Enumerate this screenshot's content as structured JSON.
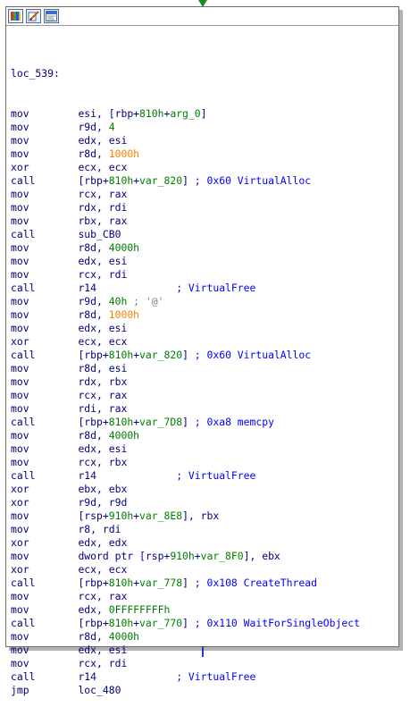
{
  "toolbar": {
    "buttons": [
      {
        "name": "color-palette-icon"
      },
      {
        "name": "edit-node-icon"
      },
      {
        "name": "graph-view-icon"
      }
    ]
  },
  "label": "loc_539:",
  "lines": [
    {
      "m": "mov",
      "p": [
        [
          "esi, [rbp+",
          "op"
        ],
        [
          "810h",
          "num"
        ],
        [
          "+",
          "op"
        ],
        [
          "arg_0",
          "var"
        ],
        [
          "]",
          "op"
        ]
      ]
    },
    {
      "m": "mov",
      "p": [
        [
          "r9d, ",
          "op"
        ],
        [
          "4",
          "num"
        ]
      ]
    },
    {
      "m": "mov",
      "p": [
        [
          "edx, esi",
          "op"
        ]
      ]
    },
    {
      "m": "mov",
      "p": [
        [
          "r8d, ",
          "op"
        ],
        [
          "1000h",
          "addr"
        ]
      ]
    },
    {
      "m": "xor",
      "p": [
        [
          "ecx, ecx",
          "op"
        ]
      ]
    },
    {
      "m": "call",
      "p": [
        [
          "[rbp+",
          "op"
        ],
        [
          "810h",
          "num"
        ],
        [
          "+",
          "op"
        ],
        [
          "var_820",
          "var"
        ],
        [
          "] ",
          "op"
        ],
        [
          "; 0x60 VirtualAlloc",
          "cmt"
        ]
      ]
    },
    {
      "m": "mov",
      "p": [
        [
          "rcx, rax",
          "op"
        ]
      ]
    },
    {
      "m": "mov",
      "p": [
        [
          "rdx, rdi",
          "op"
        ]
      ]
    },
    {
      "m": "mov",
      "p": [
        [
          "rbx, rax",
          "op"
        ]
      ]
    },
    {
      "m": "call",
      "p": [
        [
          "sub_CB0",
          "op"
        ]
      ]
    },
    {
      "m": "mov",
      "p": [
        [
          "r8d, ",
          "op"
        ],
        [
          "4000h",
          "num"
        ]
      ]
    },
    {
      "m": "mov",
      "p": [
        [
          "edx, esi",
          "op"
        ]
      ]
    },
    {
      "m": "mov",
      "p": [
        [
          "rcx, rdi",
          "op"
        ]
      ]
    },
    {
      "m": "call",
      "p": [
        [
          "r14             ",
          "op"
        ],
        [
          "; VirtualFree",
          "cmt"
        ]
      ]
    },
    {
      "m": "mov",
      "p": [
        [
          "r9d, ",
          "op"
        ],
        [
          "40h",
          "num"
        ],
        [
          " ; '@'",
          "str"
        ]
      ]
    },
    {
      "m": "mov",
      "p": [
        [
          "r8d, ",
          "op"
        ],
        [
          "1000h",
          "addr"
        ]
      ]
    },
    {
      "m": "mov",
      "p": [
        [
          "edx, esi",
          "op"
        ]
      ]
    },
    {
      "m": "xor",
      "p": [
        [
          "ecx, ecx",
          "op"
        ]
      ]
    },
    {
      "m": "call",
      "p": [
        [
          "[rbp+",
          "op"
        ],
        [
          "810h",
          "num"
        ],
        [
          "+",
          "op"
        ],
        [
          "var_820",
          "var"
        ],
        [
          "] ",
          "op"
        ],
        [
          "; 0x60 VirtualAlloc",
          "cmt"
        ]
      ]
    },
    {
      "m": "mov",
      "p": [
        [
          "r8d, esi",
          "op"
        ]
      ]
    },
    {
      "m": "mov",
      "p": [
        [
          "rdx, rbx",
          "op"
        ]
      ]
    },
    {
      "m": "mov",
      "p": [
        [
          "rcx, rax",
          "op"
        ]
      ]
    },
    {
      "m": "mov",
      "p": [
        [
          "rdi, rax",
          "op"
        ]
      ]
    },
    {
      "m": "call",
      "p": [
        [
          "[rbp+",
          "op"
        ],
        [
          "810h",
          "num"
        ],
        [
          "+",
          "op"
        ],
        [
          "var_7D8",
          "var"
        ],
        [
          "] ",
          "op"
        ],
        [
          "; 0xa8 memcpy",
          "cmt"
        ]
      ]
    },
    {
      "m": "mov",
      "p": [
        [
          "r8d, ",
          "op"
        ],
        [
          "4000h",
          "num"
        ]
      ]
    },
    {
      "m": "mov",
      "p": [
        [
          "edx, esi",
          "op"
        ]
      ]
    },
    {
      "m": "mov",
      "p": [
        [
          "rcx, rbx",
          "op"
        ]
      ]
    },
    {
      "m": "call",
      "p": [
        [
          "r14             ",
          "op"
        ],
        [
          "; VirtualFree",
          "cmt"
        ]
      ]
    },
    {
      "m": "xor",
      "p": [
        [
          "ebx, ebx",
          "op"
        ]
      ]
    },
    {
      "m": "xor",
      "p": [
        [
          "r9d, r9d",
          "op"
        ]
      ]
    },
    {
      "m": "mov",
      "p": [
        [
          "[rsp+",
          "op"
        ],
        [
          "910h",
          "num"
        ],
        [
          "+",
          "op"
        ],
        [
          "var_8E8",
          "var"
        ],
        [
          "], rbx",
          "op"
        ]
      ]
    },
    {
      "m": "mov",
      "p": [
        [
          "r8, rdi",
          "op"
        ]
      ]
    },
    {
      "m": "xor",
      "p": [
        [
          "edx, edx",
          "op"
        ]
      ]
    },
    {
      "m": "mov",
      "p": [
        [
          "dword ptr [rsp+",
          "op"
        ],
        [
          "910h",
          "num"
        ],
        [
          "+",
          "op"
        ],
        [
          "var_8F0",
          "var"
        ],
        [
          "], ebx",
          "op"
        ]
      ]
    },
    {
      "m": "xor",
      "p": [
        [
          "ecx, ecx",
          "op"
        ]
      ]
    },
    {
      "m": "call",
      "p": [
        [
          "[rbp+",
          "op"
        ],
        [
          "810h",
          "num"
        ],
        [
          "+",
          "op"
        ],
        [
          "var_778",
          "var"
        ],
        [
          "] ",
          "op"
        ],
        [
          "; 0x108 CreateThread",
          "cmt"
        ]
      ]
    },
    {
      "m": "mov",
      "p": [
        [
          "rcx, rax",
          "op"
        ]
      ]
    },
    {
      "m": "mov",
      "p": [
        [
          "edx, ",
          "op"
        ],
        [
          "0FFFFFFFFh",
          "num"
        ]
      ]
    },
    {
      "m": "call",
      "p": [
        [
          "[rbp+",
          "op"
        ],
        [
          "810h",
          "num"
        ],
        [
          "+",
          "op"
        ],
        [
          "var_770",
          "var"
        ],
        [
          "] ",
          "op"
        ],
        [
          "; 0x110 WaitForSingleObject",
          "cmt"
        ]
      ]
    },
    {
      "m": "mov",
      "p": [
        [
          "r8d, ",
          "op"
        ],
        [
          "4000h",
          "num"
        ]
      ]
    },
    {
      "m": "mov",
      "p": [
        [
          "edx, esi",
          "op"
        ]
      ]
    },
    {
      "m": "mov",
      "p": [
        [
          "rcx, rdi",
          "op"
        ]
      ]
    },
    {
      "m": "call",
      "p": [
        [
          "r14             ",
          "op"
        ],
        [
          "; VirtualFree",
          "cmt"
        ]
      ]
    },
    {
      "m": "jmp",
      "p": [
        [
          "loc_480",
          "op"
        ]
      ]
    }
  ]
}
